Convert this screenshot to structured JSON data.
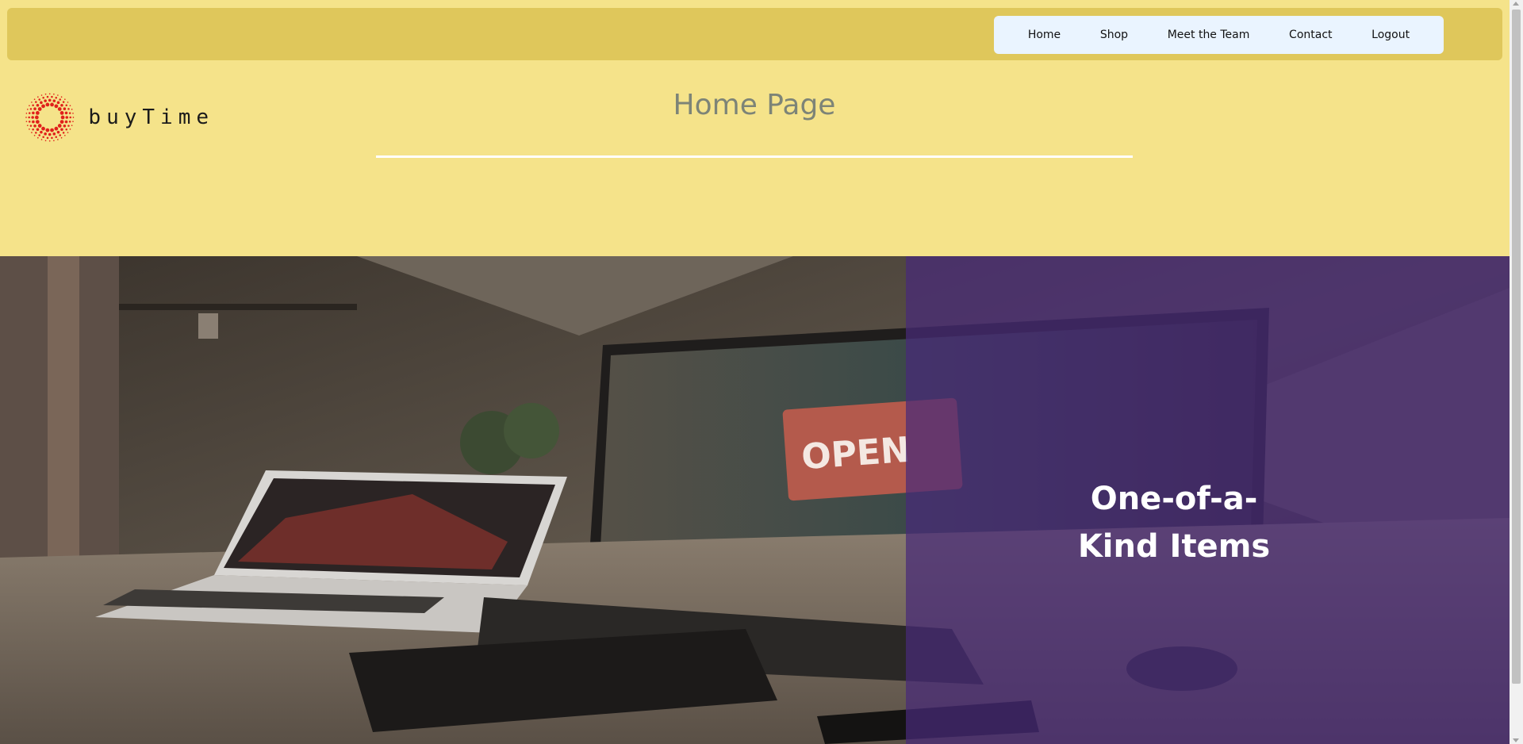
{
  "nav": {
    "links": [
      "Home",
      "Shop",
      "Meet the Team",
      "Contact",
      "Logout"
    ]
  },
  "logo": {
    "text": "buyTime",
    "icon": "sunburst-dots-icon"
  },
  "header": {
    "title": "Home Page"
  },
  "hero": {
    "heading": "One-of-a-Kind Items",
    "photo": "desk-with-laptop-monitor-open-sign-photo",
    "overlay_color": "#482a78"
  },
  "colors": {
    "page_background": "#f5e38a",
    "navbar": "#dfc75b",
    "nav_box": "#eaf4ff",
    "title_text": "#7d8477"
  }
}
